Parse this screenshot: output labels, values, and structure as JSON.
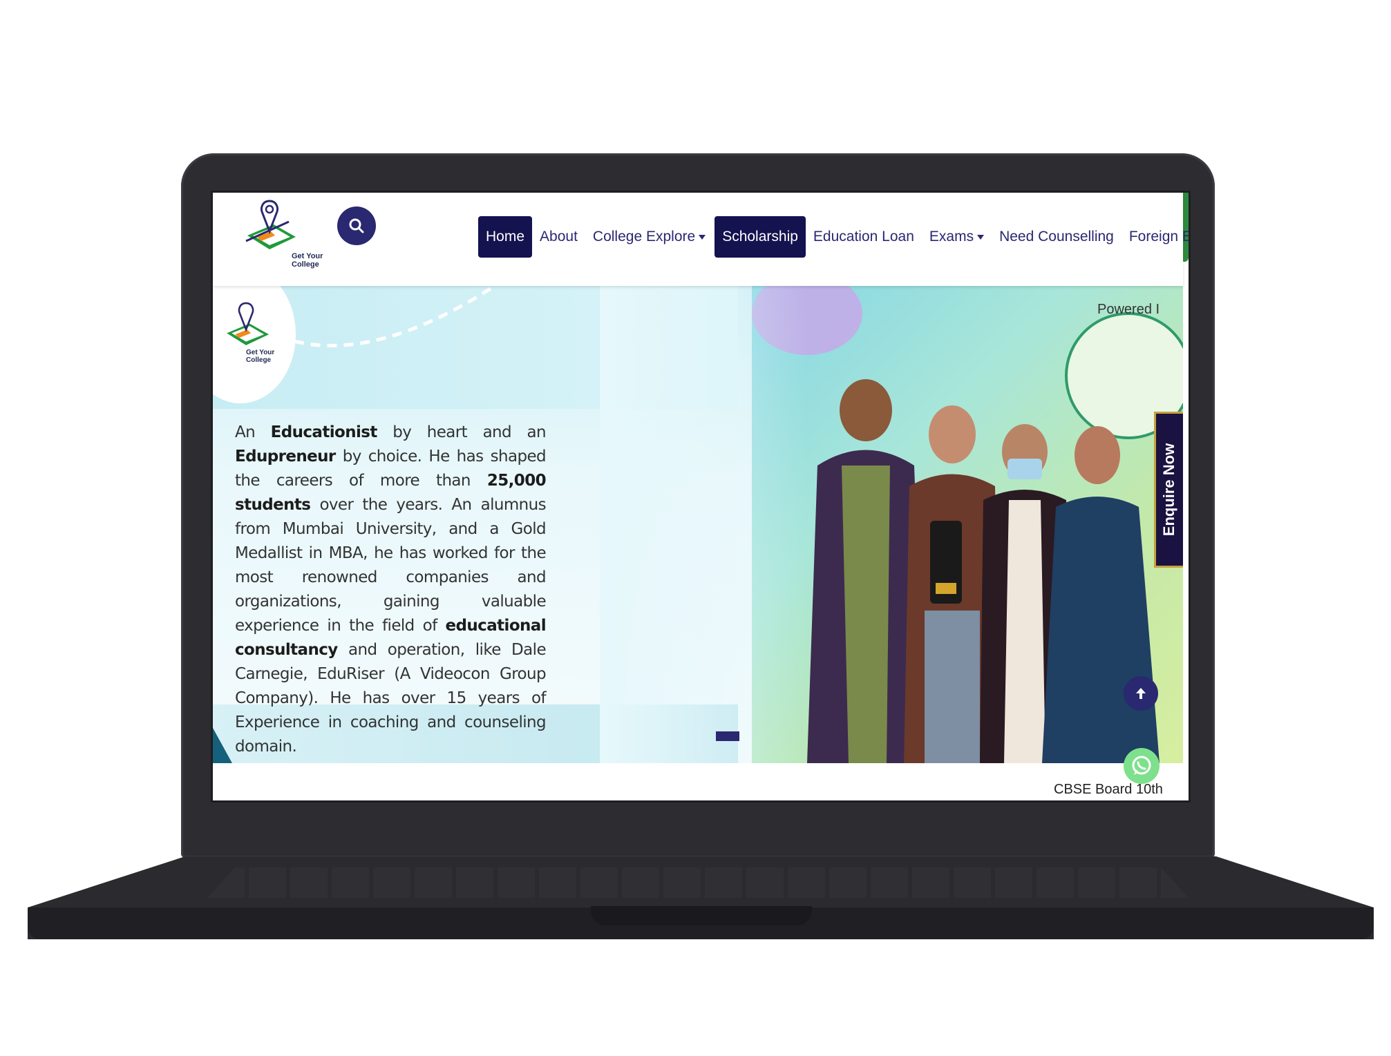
{
  "brand": {
    "logo_line1": "Get Your",
    "logo_line2": "College"
  },
  "nav": {
    "items": [
      {
        "label": "Home",
        "active": true
      },
      {
        "label": "About",
        "active": false
      },
      {
        "label": "College Explore",
        "active": false,
        "dropdown": true
      },
      {
        "label": "Scholarship",
        "active": true
      },
      {
        "label": "Education Loan",
        "active": false
      },
      {
        "label": "Exams",
        "active": false,
        "dropdown": true
      },
      {
        "label": "Need Counselling",
        "active": false
      },
      {
        "label": "Foreign Education",
        "active": false
      }
    ]
  },
  "hero": {
    "bio": {
      "p1": "An ",
      "b1": "Educationist",
      "p2": " by heart and an ",
      "b2": "Edupreneur",
      "p3": " by choice. He has shaped the careers of more than ",
      "b3": "25,000 students",
      "p4": " over the years. An alumnus from Mumbai University, and a Gold Medallist in MBA, he has worked for the most renowned companies and organizations, gaining valuable experience in the field of ",
      "b4": "educational consultancy",
      "p5": " and operation, like Dale Carnegie, EduRiser (A Videocon Group Company). He has over 15 years of Experience in coaching and counseling domain."
    },
    "photo_caption": "Powered I"
  },
  "enquire_label": "Enquire Now",
  "ticker_text": "CBSE Board 10th",
  "colors": {
    "primary": "#2a2870",
    "active_nav": "#14124f",
    "enquire_bg": "#1a1240",
    "whatsapp": "#7ee08c"
  },
  "icons": [
    "search-icon",
    "grid-menu-icon",
    "arrow-up-icon",
    "whatsapp-icon",
    "map-pin-logo-icon"
  ]
}
